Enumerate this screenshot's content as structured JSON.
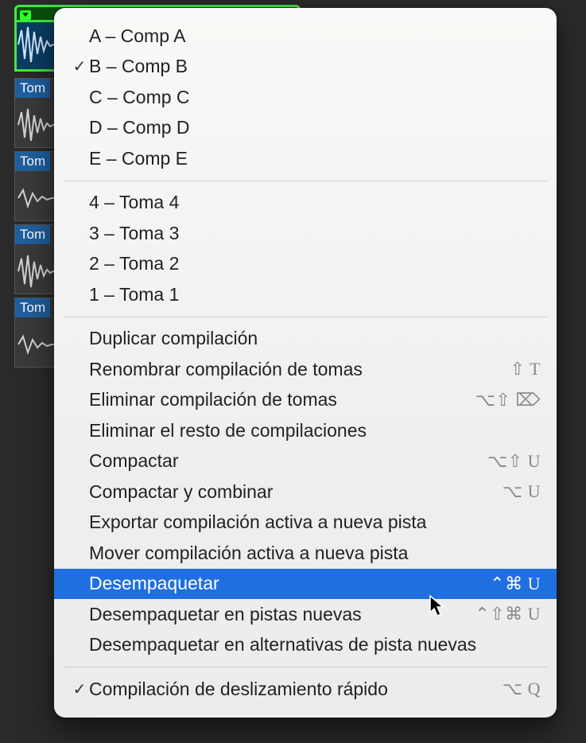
{
  "tracks": {
    "takes": [
      {
        "label": "Tom"
      },
      {
        "label": "Tom"
      },
      {
        "label": "Tom"
      },
      {
        "label": "Tom"
      }
    ]
  },
  "menu": {
    "comps": [
      {
        "checked": false,
        "label": "A – Comp A"
      },
      {
        "checked": true,
        "label": "B – Comp B"
      },
      {
        "checked": false,
        "label": "C – Comp C"
      },
      {
        "checked": false,
        "label": "D – Comp D"
      },
      {
        "checked": false,
        "label": "E – Comp E"
      }
    ],
    "takes_list": [
      {
        "label": "4 – Toma 4"
      },
      {
        "label": "3 – Toma 3"
      },
      {
        "label": "2 – Toma 2"
      },
      {
        "label": "1 – Toma 1"
      }
    ],
    "actions": [
      {
        "label": "Duplicar compilación",
        "shortcut": "",
        "highlighted": false
      },
      {
        "label": "Renombrar compilación de tomas",
        "shortcut": "⇧ T",
        "highlighted": false
      },
      {
        "label": "Eliminar compilación de tomas",
        "shortcut": "⌥⇧ ⌦",
        "highlighted": false
      },
      {
        "label": "Eliminar el resto de compilaciones",
        "shortcut": "",
        "highlighted": false
      },
      {
        "label": "Compactar",
        "shortcut": "⌥⇧ U",
        "highlighted": false
      },
      {
        "label": "Compactar y combinar",
        "shortcut": "⌥ U",
        "highlighted": false
      },
      {
        "label": "Exportar compilación activa a nueva pista",
        "shortcut": "",
        "highlighted": false
      },
      {
        "label": "Mover compilación activa a nueva pista",
        "shortcut": "",
        "highlighted": false
      },
      {
        "label": "Desempaquetar",
        "shortcut": "⌃⌘ U",
        "highlighted": true
      },
      {
        "label": "Desempaquetar en pistas nuevas",
        "shortcut": "⌃⇧⌘ U",
        "highlighted": false
      },
      {
        "label": "Desempaquetar en alternativas de pista nuevas",
        "shortcut": "",
        "highlighted": false
      }
    ],
    "footer": {
      "checked": true,
      "label": "Compilación de deslizamiento rápido",
      "shortcut": "⌥ Q"
    }
  }
}
